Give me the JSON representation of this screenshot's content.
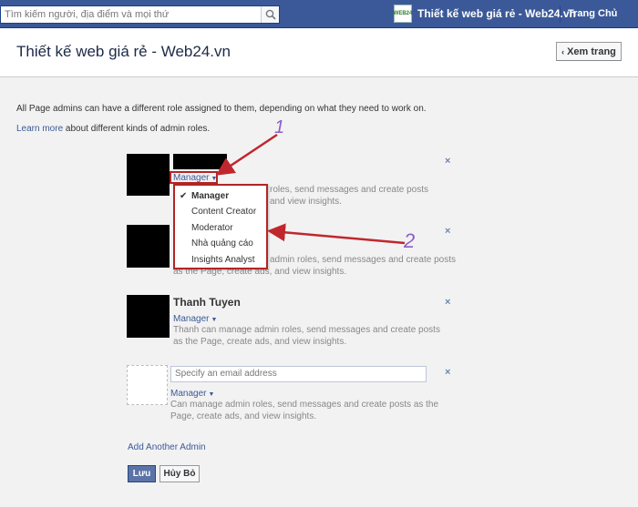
{
  "topbar": {
    "search_placeholder": "Tìm kiếm người, địa điểm và mọi thứ",
    "page_logo_text": "WEB24",
    "page_name": "Thiết kế web giá rẻ - Web24.vn",
    "home_label": "Trang Chủ"
  },
  "header": {
    "title": "Thiết kế web giá rẻ - Web24.vn",
    "view_page_label": "Xem trang"
  },
  "intro": {
    "text": "All Page admins can have a different role assigned to them, depending on what they need to work on.",
    "learn_more": "Learn more",
    "learn_suffix": " about different kinds of admin roles."
  },
  "admins": [
    {
      "name": "",
      "role": "Manager",
      "desc_line1": "roles, send messages and create posts",
      "desc_line2": "and view insights."
    },
    {
      "name": "",
      "role": "Manager",
      "desc_line1": "admin roles, send messages and create posts",
      "desc_line2": "as the Page, create ads, and view insights."
    },
    {
      "name": "Thanh Tuyen",
      "role": "Manager",
      "desc_line1": "Thanh can manage admin roles, send messages and create posts",
      "desc_line2": "as the Page, create ads, and view insights."
    }
  ],
  "new_admin": {
    "email_placeholder": "Specify an email address",
    "role": "Manager",
    "desc_line1": "Can manage admin roles, send messages and create posts as the",
    "desc_line2": "Page, create ads, and view insights."
  },
  "role_dropdown": {
    "options": [
      "Manager",
      "Content Creator",
      "Moderator",
      "Nhà quảng cáo",
      "Insights Analyst"
    ],
    "selected": "Manager"
  },
  "remove_symbol": "×",
  "add_admin_label": "Add Another Admin",
  "save_label": "Lưu",
  "cancel_label": "Hủy Bỏ",
  "annotations": {
    "label_1": "1",
    "label_2": "2",
    "color": "#c0272d",
    "label_color": "#8a5fc8"
  }
}
